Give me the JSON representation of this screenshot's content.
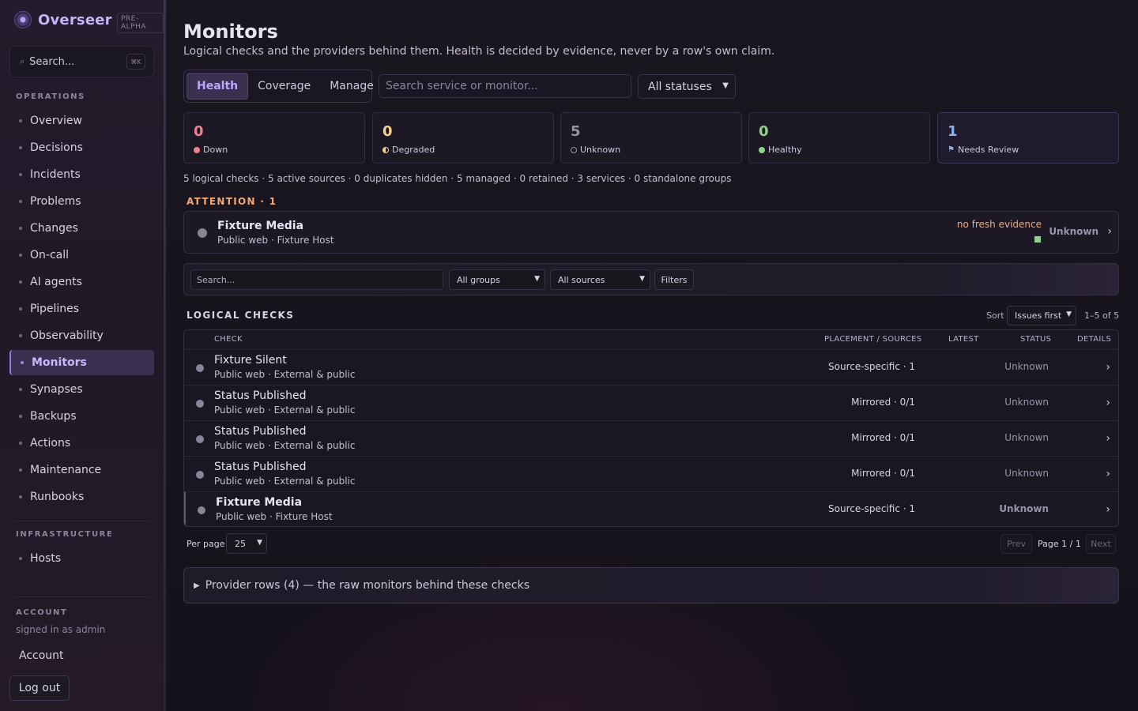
{
  "sidebar": {
    "brand": "Overseer",
    "tag": "PRE-ALPHA",
    "search_placeholder": "Search...",
    "search_shortcut": "⌘K",
    "operations_label": "OPERATIONS",
    "operations": [
      "Overview",
      "Decisions",
      "Incidents",
      "Problems",
      "Changes",
      "On-call",
      "AI agents",
      "Pipelines",
      "Observability",
      "Monitors",
      "Synapses",
      "Backups",
      "Actions",
      "Maintenance",
      "Runbooks"
    ],
    "active_item": "Monitors",
    "infrastructure_label": "INFRASTRUCTURE",
    "infrastructure": [
      "Hosts"
    ],
    "account_label": "ACCOUNT",
    "signed_in": "signed in as admin",
    "account_link": "Account",
    "logout": "Log out"
  },
  "page": {
    "title": "Monitors",
    "subtitle": "Logical checks and the providers behind them. Health is decided by evidence, never by a row's own claim.",
    "tabs": [
      "Health",
      "Coverage",
      "Manage"
    ],
    "active_tab": "Health",
    "search_placeholder": "Search service or monitor...",
    "status_filter": "All statuses"
  },
  "cards": [
    {
      "count": "0",
      "label": "Down",
      "color": "#f07f8f"
    },
    {
      "count": "0",
      "label": "Degraded",
      "color": "#f5d38a"
    },
    {
      "count": "5",
      "label": "Unknown",
      "color": "#9a93a8"
    },
    {
      "count": "0",
      "label": "Healthy",
      "color": "#8fd18c"
    },
    {
      "count": "1",
      "label": "Needs Review",
      "color": "#8fb0f0"
    }
  ],
  "meta": "5 logical checks · 5 active sources · 0 duplicates hidden · 5 managed · 0 retained · 3 services · 0 standalone groups",
  "attention": {
    "label": "ATTENTION · 1",
    "title": "Fixture Media",
    "sub": "Public web · Fixture Host",
    "evidence": "no fresh evidence",
    "status": "Unknown"
  },
  "filters": {
    "search_placeholder": "Search...",
    "groups": "All groups",
    "sources": "All sources",
    "filters_button": "Filters"
  },
  "logical": {
    "label": "LOGICAL CHECKS",
    "sort_label": "Sort",
    "sort_value": "Issues first",
    "range": "1–5 of 5",
    "headers": {
      "check": "CHECK",
      "placement": "PLACEMENT / SOURCES",
      "latest": "LATEST",
      "status": "STATUS",
      "details": "DETAILS"
    },
    "rows": [
      {
        "name": "Fixture Silent",
        "sub": "Public web · External & public",
        "placement": "Source-specific · 1",
        "status": "Unknown"
      },
      {
        "name": "Status Published",
        "sub": "Public web · External & public",
        "placement": "Mirrored · 0/1",
        "status": "Unknown"
      },
      {
        "name": "Status Published",
        "sub": "Public web · External & public",
        "placement": "Mirrored · 0/1",
        "status": "Unknown"
      },
      {
        "name": "Status Published",
        "sub": "Public web · External & public",
        "placement": "Mirrored · 0/1",
        "status": "Unknown"
      },
      {
        "name": "Fixture Media",
        "sub": "Public web · Fixture Host",
        "placement": "Source-specific · 1",
        "status": "Unknown"
      }
    ]
  },
  "pagination": {
    "per_page_label": "Per page",
    "per_page": "25",
    "prev": "Prev",
    "page_info": "Page 1 / 1",
    "next": "Next"
  },
  "provider": "Provider rows (4) — the raw monitors behind these checks"
}
